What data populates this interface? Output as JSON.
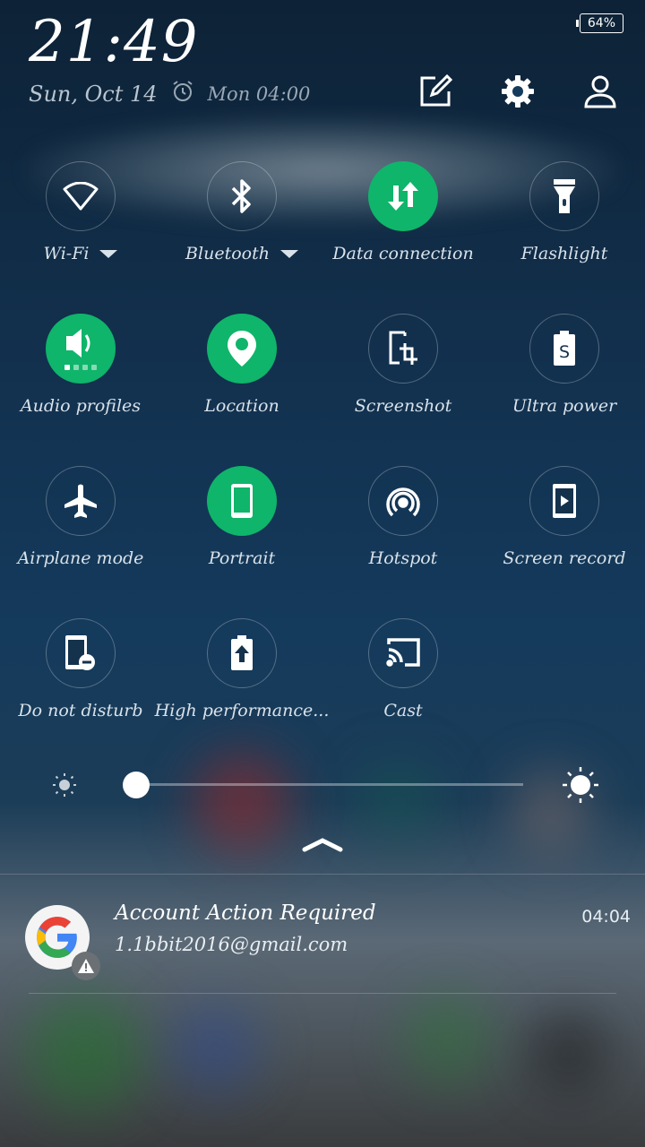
{
  "status": {
    "battery": "64%"
  },
  "header": {
    "time": "21:49",
    "date": "Sun, Oct 14",
    "alarm": "Mon 04:00"
  },
  "top_icons": [
    "edit-icon",
    "settings-gear-icon",
    "account-icon"
  ],
  "tiles": [
    {
      "label": "Wi-Fi",
      "icon": "wifi-icon",
      "active": false,
      "has_dropdown": true
    },
    {
      "label": "Bluetooth",
      "icon": "bluetooth-icon",
      "active": false,
      "has_dropdown": true
    },
    {
      "label": "Data connection",
      "icon": "data-transfer-icon",
      "active": true
    },
    {
      "label": "Flashlight",
      "icon": "flashlight-icon",
      "active": false
    },
    {
      "label": "Audio profiles",
      "icon": "speaker-icon",
      "active": true
    },
    {
      "label": "Location",
      "icon": "location-pin-icon",
      "active": true
    },
    {
      "label": "Screenshot",
      "icon": "screenshot-icon",
      "active": false
    },
    {
      "label": "Ultra power",
      "icon": "ultra-power-icon",
      "active": false
    },
    {
      "label": "Airplane mode",
      "icon": "airplane-icon",
      "active": false
    },
    {
      "label": "Portrait",
      "icon": "portrait-icon",
      "active": true
    },
    {
      "label": "Hotspot",
      "icon": "hotspot-icon",
      "active": false
    },
    {
      "label": "Screen record",
      "icon": "screen-record-icon",
      "active": false
    },
    {
      "label": "Do not disturb",
      "icon": "do-not-disturb-icon",
      "active": false
    },
    {
      "label": "High performance...",
      "icon": "high-performance-icon",
      "active": false
    },
    {
      "label": "Cast",
      "icon": "cast-icon",
      "active": false
    }
  ],
  "brightness": {
    "level": 0.0
  },
  "notification": {
    "app_icon": "google-g-icon",
    "badge_icon": "warning-icon",
    "title": "Account Action Required",
    "subtitle": "1.1bbit2016@gmail.com",
    "time": "04:04"
  },
  "colors": {
    "accent": "#0fb56a"
  }
}
